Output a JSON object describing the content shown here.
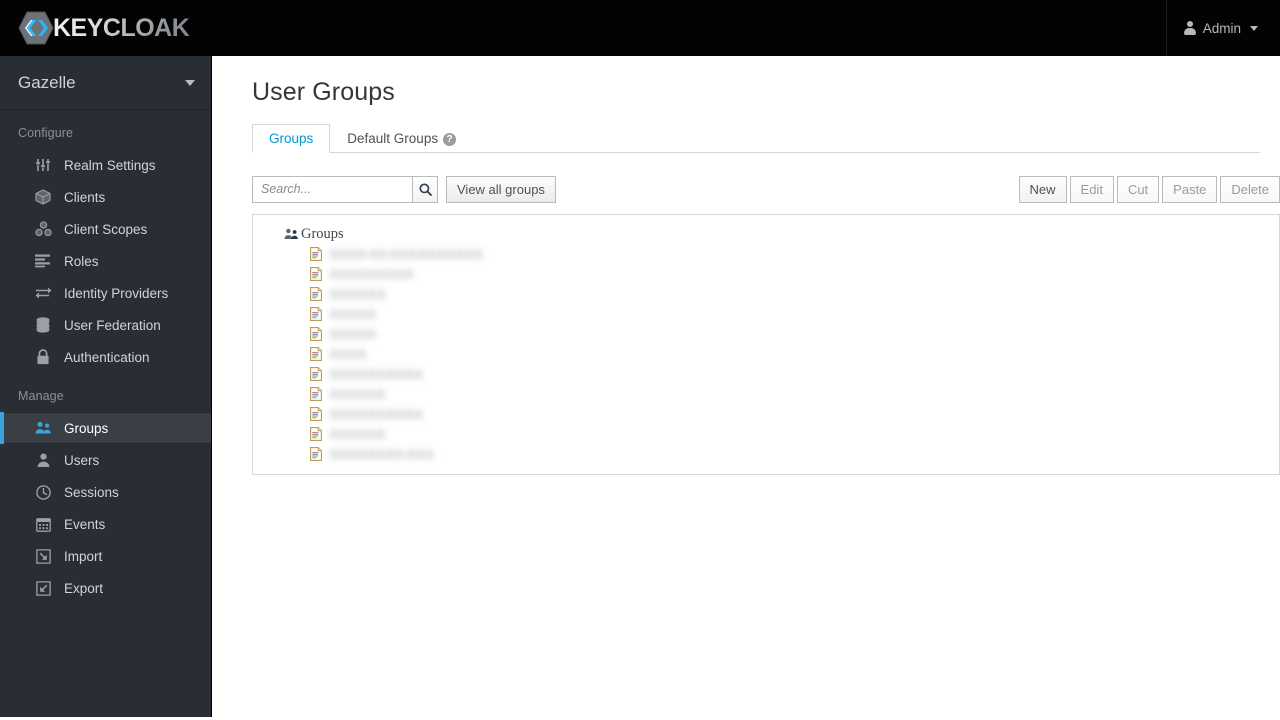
{
  "topbar": {
    "brand_name": "KEYCLOAK",
    "brand_icon": "keycloak-hex-logo",
    "user_icon": "user-icon",
    "user_label": "Admin",
    "caret_icon": "chevron-down-icon"
  },
  "sidebar": {
    "realm": {
      "name": "Gazelle",
      "caret_icon": "chevron-down-icon"
    },
    "sections": [
      {
        "label": "Configure",
        "items": [
          {
            "label": "Realm Settings",
            "icon": "sliders-icon",
            "active": false
          },
          {
            "label": "Clients",
            "icon": "cube-icon",
            "active": false
          },
          {
            "label": "Client Scopes",
            "icon": "cubes-icon",
            "active": false
          },
          {
            "label": "Roles",
            "icon": "list-bars-icon",
            "active": false
          },
          {
            "label": "Identity Providers",
            "icon": "exchange-arrows-icon",
            "active": false
          },
          {
            "label": "User Federation",
            "icon": "database-icon",
            "active": false
          },
          {
            "label": "Authentication",
            "icon": "lock-icon",
            "active": false
          }
        ]
      },
      {
        "label": "Manage",
        "items": [
          {
            "label": "Groups",
            "icon": "users-group-icon",
            "active": true
          },
          {
            "label": "Users",
            "icon": "user-icon",
            "active": false
          },
          {
            "label": "Sessions",
            "icon": "clock-icon",
            "active": false
          },
          {
            "label": "Events",
            "icon": "calendar-icon",
            "active": false
          },
          {
            "label": "Import",
            "icon": "import-arrow-icon",
            "active": false
          },
          {
            "label": "Export",
            "icon": "export-arrow-icon",
            "active": false
          }
        ]
      }
    ]
  },
  "main": {
    "page_title": "User Groups",
    "tabs": [
      {
        "label": "Groups",
        "active": true,
        "help": false
      },
      {
        "label": "Default Groups",
        "active": false,
        "help": true,
        "help_glyph": "?"
      }
    ],
    "toolbar": {
      "search_placeholder": "Search...",
      "search_value": "",
      "search_icon": "search-icon",
      "view_all_label": "View all groups",
      "actions": [
        {
          "label": "New",
          "disabled": false
        },
        {
          "label": "Edit",
          "disabled": true
        },
        {
          "label": "Cut",
          "disabled": true
        },
        {
          "label": "Paste",
          "disabled": true
        },
        {
          "label": "Delete",
          "disabled": true
        }
      ]
    },
    "tree": {
      "root_label": "Groups",
      "root_icon": "users-group-icon",
      "children": [
        {
          "label": "AAAA AA AAAAAAAAAA",
          "icon": "file-document-icon",
          "redacted": true
        },
        {
          "label": "AAAAAAAAA",
          "icon": "file-document-icon",
          "redacted": true
        },
        {
          "label": "AAAAAA",
          "icon": "file-document-icon",
          "redacted": true
        },
        {
          "label": "AAAAA",
          "icon": "file-document-icon",
          "redacted": true
        },
        {
          "label": "AAAAA",
          "icon": "file-document-icon",
          "redacted": true
        },
        {
          "label": "AAAA",
          "icon": "file-document-icon",
          "redacted": true
        },
        {
          "label": "AAAAAAAAAA",
          "icon": "file-document-icon",
          "redacted": true
        },
        {
          "label": "AAAAAA",
          "icon": "file-document-icon",
          "redacted": true
        },
        {
          "label": "AAAAAAAAAA",
          "icon": "file-document-icon",
          "redacted": true
        },
        {
          "label": "AAAAAA",
          "icon": "file-document-icon",
          "redacted": true
        },
        {
          "label": "AAAAAAAA AAA",
          "icon": "file-document-icon",
          "redacted": true
        }
      ]
    }
  },
  "colors": {
    "topbar_bg": "#030303",
    "sidebar_bg": "#292e34",
    "sidebar_active_bg": "#393f44",
    "accent_blue": "#39a5dc",
    "tab_active_text": "#0099d3",
    "page_bg": "#ffffff",
    "panel_border": "#d6d6d6"
  }
}
